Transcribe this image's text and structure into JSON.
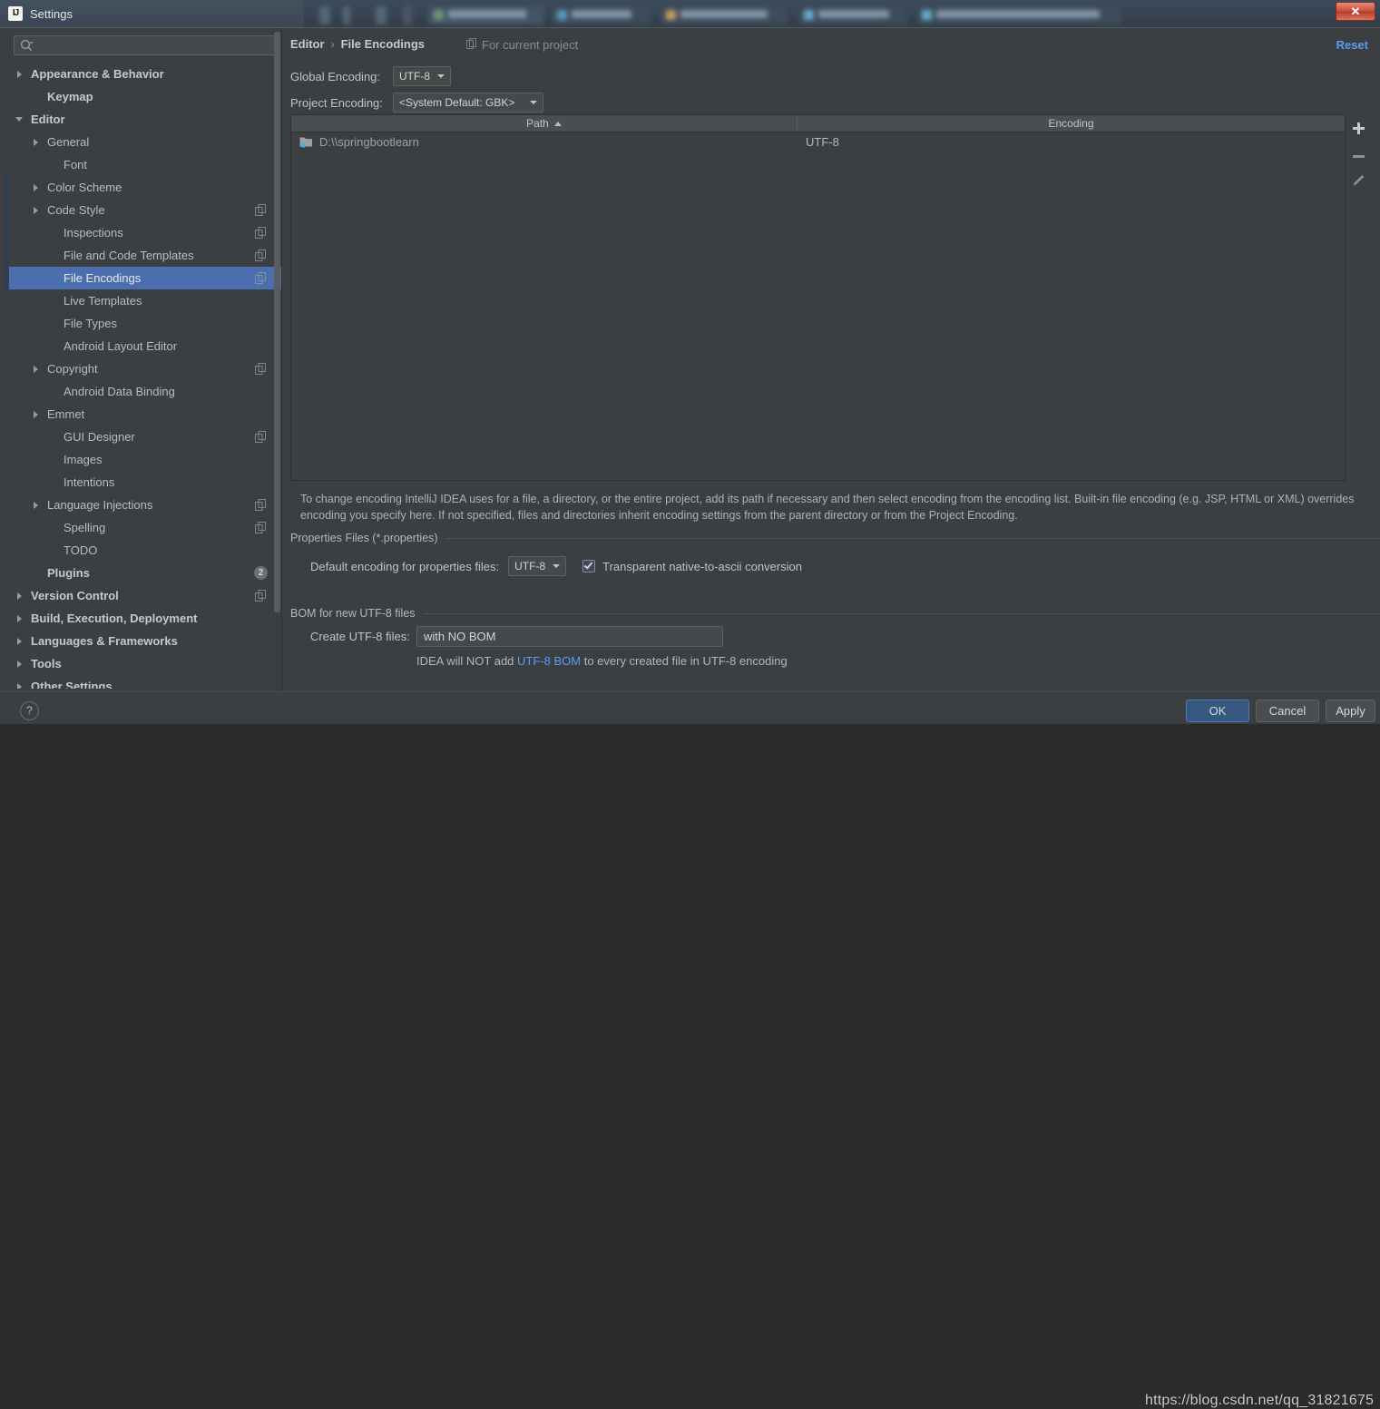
{
  "window": {
    "title": "Settings",
    "logo_text": "IJ",
    "close_label": "✕"
  },
  "search": {
    "value": "",
    "placeholder": ""
  },
  "sidebar": {
    "items": [
      {
        "label": "Appearance & Behavior",
        "indent": 0,
        "arrow": "right",
        "bold": true,
        "badge": "",
        "copy": false,
        "selected": false
      },
      {
        "label": "Keymap",
        "indent": 1,
        "arrow": "none",
        "bold": true,
        "badge": "",
        "copy": false,
        "selected": false
      },
      {
        "label": "Editor",
        "indent": 0,
        "arrow": "down",
        "bold": true,
        "badge": "",
        "copy": false,
        "selected": false
      },
      {
        "label": "General",
        "indent": 1,
        "arrow": "right",
        "bold": false,
        "badge": "",
        "copy": false,
        "selected": false
      },
      {
        "label": "Font",
        "indent": 2,
        "arrow": "none",
        "bold": false,
        "badge": "",
        "copy": false,
        "selected": false
      },
      {
        "label": "Color Scheme",
        "indent": 1,
        "arrow": "right",
        "bold": false,
        "badge": "",
        "copy": false,
        "selected": false
      },
      {
        "label": "Code Style",
        "indent": 1,
        "arrow": "right",
        "bold": false,
        "badge": "",
        "copy": true,
        "selected": false
      },
      {
        "label": "Inspections",
        "indent": 2,
        "arrow": "none",
        "bold": false,
        "badge": "",
        "copy": true,
        "selected": false
      },
      {
        "label": "File and Code Templates",
        "indent": 2,
        "arrow": "none",
        "bold": false,
        "badge": "",
        "copy": true,
        "selected": false
      },
      {
        "label": "File Encodings",
        "indent": 2,
        "arrow": "none",
        "bold": false,
        "badge": "",
        "copy": true,
        "selected": true
      },
      {
        "label": "Live Templates",
        "indent": 2,
        "arrow": "none",
        "bold": false,
        "badge": "",
        "copy": false,
        "selected": false
      },
      {
        "label": "File Types",
        "indent": 2,
        "arrow": "none",
        "bold": false,
        "badge": "",
        "copy": false,
        "selected": false
      },
      {
        "label": "Android Layout Editor",
        "indent": 2,
        "arrow": "none",
        "bold": false,
        "badge": "",
        "copy": false,
        "selected": false
      },
      {
        "label": "Copyright",
        "indent": 1,
        "arrow": "right",
        "bold": false,
        "badge": "",
        "copy": true,
        "selected": false
      },
      {
        "label": "Android Data Binding",
        "indent": 2,
        "arrow": "none",
        "bold": false,
        "badge": "",
        "copy": false,
        "selected": false
      },
      {
        "label": "Emmet",
        "indent": 1,
        "arrow": "right",
        "bold": false,
        "badge": "",
        "copy": false,
        "selected": false
      },
      {
        "label": "GUI Designer",
        "indent": 2,
        "arrow": "none",
        "bold": false,
        "badge": "",
        "copy": true,
        "selected": false
      },
      {
        "label": "Images",
        "indent": 2,
        "arrow": "none",
        "bold": false,
        "badge": "",
        "copy": false,
        "selected": false
      },
      {
        "label": "Intentions",
        "indent": 2,
        "arrow": "none",
        "bold": false,
        "badge": "",
        "copy": false,
        "selected": false
      },
      {
        "label": "Language Injections",
        "indent": 1,
        "arrow": "right",
        "bold": false,
        "badge": "",
        "copy": true,
        "selected": false
      },
      {
        "label": "Spelling",
        "indent": 2,
        "arrow": "none",
        "bold": false,
        "badge": "",
        "copy": true,
        "selected": false
      },
      {
        "label": "TODO",
        "indent": 2,
        "arrow": "none",
        "bold": false,
        "badge": "",
        "copy": false,
        "selected": false
      },
      {
        "label": "Plugins",
        "indent": 1,
        "arrow": "none",
        "bold": true,
        "badge": "2",
        "copy": false,
        "selected": false
      },
      {
        "label": "Version Control",
        "indent": 0,
        "arrow": "right",
        "bold": true,
        "badge": "",
        "copy": true,
        "selected": false
      },
      {
        "label": "Build, Execution, Deployment",
        "indent": 0,
        "arrow": "right",
        "bold": true,
        "badge": "",
        "copy": false,
        "selected": false
      },
      {
        "label": "Languages & Frameworks",
        "indent": 0,
        "arrow": "right",
        "bold": true,
        "badge": "",
        "copy": false,
        "selected": false
      },
      {
        "label": "Tools",
        "indent": 0,
        "arrow": "right",
        "bold": true,
        "badge": "",
        "copy": false,
        "selected": false
      },
      {
        "label": "Other Settings",
        "indent": 0,
        "arrow": "right",
        "bold": true,
        "badge": "",
        "copy": false,
        "selected": false
      }
    ]
  },
  "header": {
    "breadcrumb_parent": "Editor",
    "breadcrumb_sep": "›",
    "breadcrumb_current": "File Encodings",
    "for_current_project": "For current project",
    "reset": "Reset"
  },
  "encodings": {
    "global_label": "Global Encoding:",
    "global_value": "UTF-8",
    "project_label": "Project Encoding:",
    "project_value": "<System Default: GBK>"
  },
  "table": {
    "columns": [
      "Path",
      "Encoding"
    ],
    "sort_column": "Path",
    "sort_direction": "asc",
    "rows": [
      {
        "path": "D:\\\\springbootlearn",
        "encoding": "UTF-8"
      }
    ],
    "buttons": [
      "add",
      "remove",
      "edit"
    ]
  },
  "description": "To change encoding IntelliJ IDEA uses for a file, a directory, or the entire project, add its path if necessary and then select encoding from the encoding list. Built-in file encoding (e.g. JSP, HTML or XML) overrides encoding you specify here. If not specified, files and directories inherit encoding settings from the parent directory or from the Project Encoding.",
  "properties_section": {
    "title": "Properties Files (*.properties)",
    "default_encoding_label": "Default encoding for properties files:",
    "default_encoding_value": "UTF-8",
    "checkbox_label": "Transparent native-to-ascii conversion",
    "checkbox_checked": true
  },
  "bom_section": {
    "title": "BOM for new UTF-8 files",
    "create_label": "Create UTF-8 files:",
    "create_value": "with NO BOM",
    "note_prefix": "IDEA will NOT add ",
    "note_link": "UTF-8 BOM",
    "note_suffix": " to every created file in UTF-8 encoding"
  },
  "footer": {
    "help": "?",
    "ok": "OK",
    "cancel": "Cancel",
    "apply": "Apply"
  },
  "watermark": "https://blog.csdn.net/qq_31821675",
  "colors": {
    "selection_blue": "#4b6eaf",
    "link_blue": "#589df6",
    "panel_bg": "#3c3f41",
    "field_bg": "#45494a"
  }
}
